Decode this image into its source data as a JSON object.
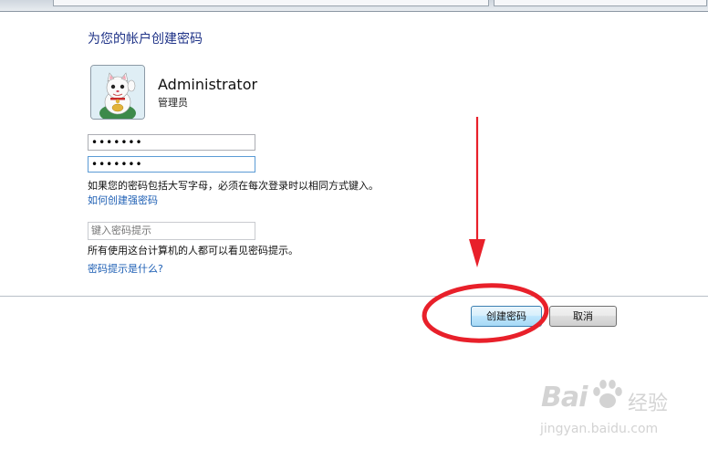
{
  "dialog": {
    "title": "为您的帐户创建密码",
    "user": {
      "name": "Administrator",
      "role": "管理员",
      "avatar_icon": "lucky-cat-icon"
    },
    "password_field": {
      "value": "•••••••"
    },
    "confirm_field": {
      "value": "•••••••"
    },
    "caps_note": "如果您的密码包括大写字母，必须在每次登录时以相同方式键入。",
    "strong_pw_link": "如何创建强密码",
    "hint_field": {
      "placeholder": "键入密码提示"
    },
    "hint_note": "所有使用这台计算机的人都可以看见密码提示。",
    "hint_link": "密码提示是什么?",
    "buttons": {
      "create": "创建密码",
      "cancel": "取消"
    }
  },
  "annotation": {
    "color": "#e8202a",
    "arrow_icon": "red-arrow-icon",
    "circle_icon": "red-circle-icon"
  },
  "watermark": {
    "brand": "Bai",
    "paw_icon": "paw-icon",
    "brand_suffix": "经验",
    "url": "jingyan.baidu.com"
  },
  "colors": {
    "title": "#1e3287",
    "link": "#1e5fb4",
    "divider": "#b9c0c7"
  }
}
